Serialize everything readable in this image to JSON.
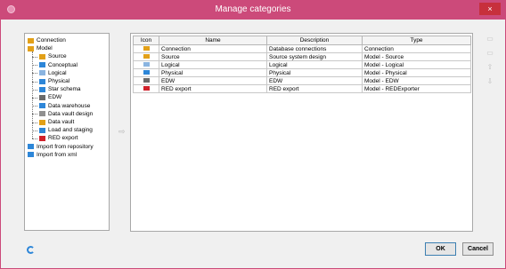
{
  "window": {
    "title": "Manage categories",
    "close_glyph": "×"
  },
  "tree": {
    "items": [
      {
        "label": "Connection",
        "icon": "connection-icon",
        "color": "#e2a018",
        "level": 0
      },
      {
        "label": "Model",
        "icon": "model-icon",
        "color": "#e2a018",
        "level": 0
      },
      {
        "label": "Source",
        "icon": "source-icon",
        "color": "#e2a018",
        "level": 1
      },
      {
        "label": "Conceptual",
        "icon": "conceptual-icon",
        "color": "#2d86d8",
        "level": 1
      },
      {
        "label": "Logical",
        "icon": "logical-icon",
        "color": "#8ab4e0",
        "level": 1
      },
      {
        "label": "Physical",
        "icon": "physical-icon",
        "color": "#2d86d8",
        "level": 1
      },
      {
        "label": "Star schema",
        "icon": "star-schema-icon",
        "color": "#2d86d8",
        "level": 1
      },
      {
        "label": "EDW",
        "icon": "edw-icon",
        "color": "#6a6a6a",
        "level": 1
      },
      {
        "label": "Data warehouse",
        "icon": "data-warehouse-icon",
        "color": "#2d86d8",
        "level": 1
      },
      {
        "label": "Data vault design",
        "icon": "data-vault-design-icon",
        "color": "#909090",
        "level": 1
      },
      {
        "label": "Data vault",
        "icon": "data-vault-icon",
        "color": "#e2a018",
        "level": 1
      },
      {
        "label": "Load and staging",
        "icon": "load-staging-icon",
        "color": "#2d86d8",
        "level": 1
      },
      {
        "label": "RED export",
        "icon": "red-export-icon",
        "color": "#d0202a",
        "level": 1
      },
      {
        "label": "Import from repository",
        "icon": "import-repository-icon",
        "color": "#2d86d8",
        "level": 0
      },
      {
        "label": "Import from xml",
        "icon": "import-xml-icon",
        "color": "#2d86d8",
        "level": 0
      }
    ]
  },
  "grid": {
    "columns": [
      "Icon",
      "Name",
      "Description",
      "Type"
    ],
    "rows": [
      {
        "icon": "connection-icon",
        "color": "#e2a018",
        "name": "Connection",
        "description": "Database connections",
        "type": "Connection"
      },
      {
        "icon": "source-icon",
        "color": "#e2a018",
        "name": "Source",
        "description": "Source system design",
        "type": "Model - Source"
      },
      {
        "icon": "logical-icon",
        "color": "#8ab4e0",
        "name": "Logical",
        "description": "Logical",
        "type": "Model - Logical"
      },
      {
        "icon": "physical-icon",
        "color": "#2d86d8",
        "name": "Physical",
        "description": "Physical",
        "type": "Model - Physical"
      },
      {
        "icon": "edw-icon",
        "color": "#6a6a6a",
        "name": "EDW",
        "description": "EDW",
        "type": "Model - EDW"
      },
      {
        "icon": "red-export-icon",
        "color": "#d0202a",
        "name": "RED export",
        "description": "RED export",
        "type": "Model - REDExporter"
      }
    ]
  },
  "buttons": {
    "ok": "OK",
    "cancel": "Cancel"
  },
  "arrows": {
    "move": "⇨",
    "up": "⇧",
    "down": "⇩",
    "add": "▭",
    "edit": "▭"
  }
}
